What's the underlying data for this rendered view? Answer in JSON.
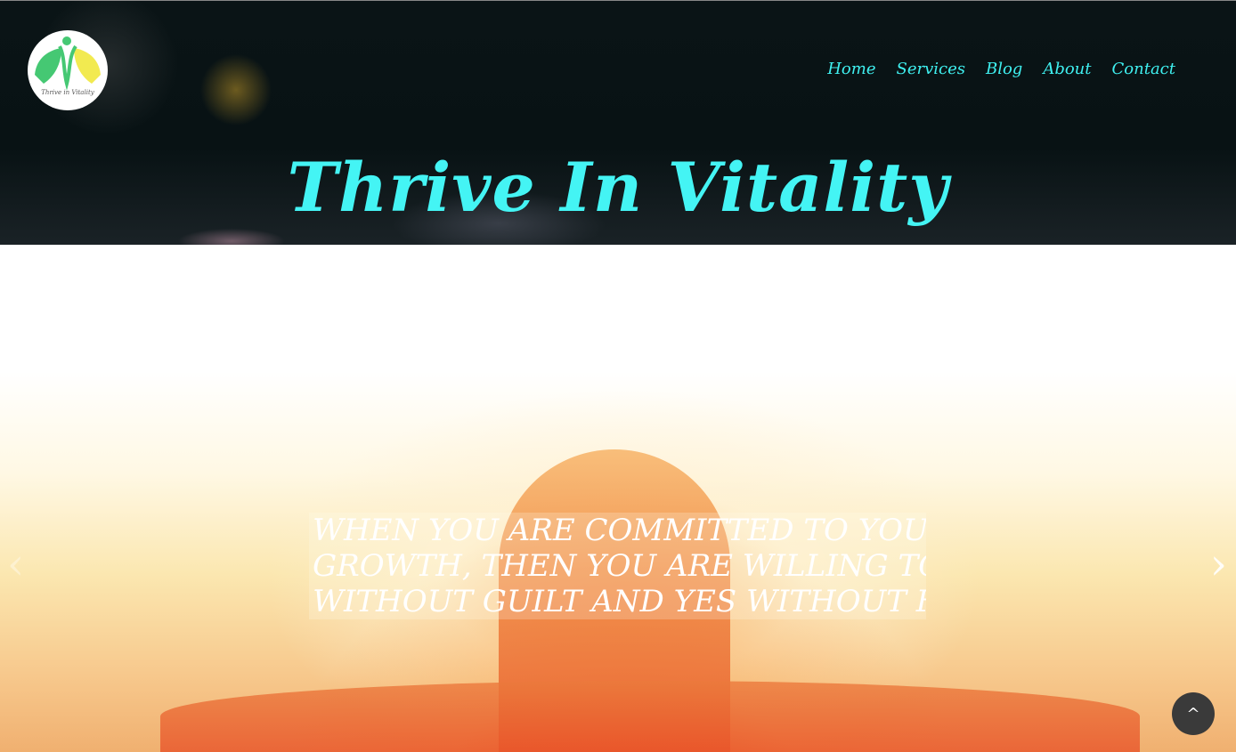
{
  "brand": {
    "logo_text": "Thrive in Vitality",
    "title": "Thrive In Vitality"
  },
  "nav": {
    "items": [
      {
        "label": "Home"
      },
      {
        "label": "Services"
      },
      {
        "label": "Blog"
      },
      {
        "label": "About"
      },
      {
        "label": "Contact"
      }
    ]
  },
  "hero": {
    "quote_lines": [
      "WHEN YOU ARE COMMITTED TO YOUR",
      "GROWTH, THEN YOU ARE WILLING TO SAY NO",
      "WITHOUT GUILT AND YES WITHOUT FEAR"
    ],
    "prev_icon": "chevron-left-icon",
    "next_icon": "chevron-right-icon"
  },
  "scroll_top": {
    "icon": "chevron-up-icon"
  },
  "colors": {
    "accent": "#44f4f4",
    "header_bg": "#081214"
  }
}
